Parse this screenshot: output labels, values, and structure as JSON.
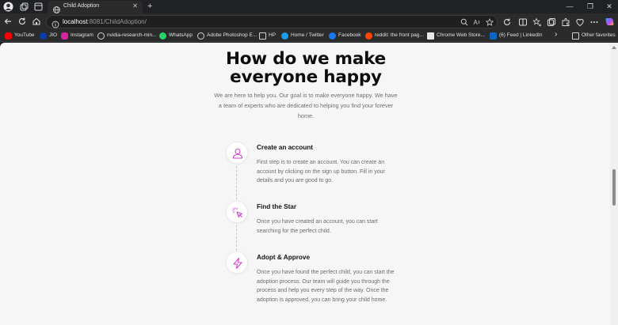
{
  "browser": {
    "tab_title": "Child Adoption",
    "tab_close": "✕",
    "new_tab": "+",
    "url_host": "localhost",
    "url_rest": ":8081/ChildAdoption/",
    "window_controls": {
      "minimize": "—",
      "restore": "❐",
      "close": "✕"
    }
  },
  "bookmarks": [
    {
      "label": "YouTube",
      "icon": "youtube-icon",
      "color": "#ff0000"
    },
    {
      "label": "JIO",
      "icon": "jio-icon",
      "color": "#0a3ea8"
    },
    {
      "label": "Instagram",
      "icon": "instagram-icon",
      "color": "#d6249f"
    },
    {
      "label": "nvidia-research-min...",
      "icon": "globe-icon",
      "color": "#cfcfcf"
    },
    {
      "label": "WhatsApp",
      "icon": "whatsapp-icon",
      "color": "#25d366"
    },
    {
      "label": "Adobe Photoshop E...",
      "icon": "globe-icon",
      "color": "#cfcfcf"
    },
    {
      "label": "HP",
      "icon": "folder-icon",
      "color": "#cfcfcf"
    },
    {
      "label": "Home / Twitter",
      "icon": "twitter-icon",
      "color": "#1d9bf0"
    },
    {
      "label": "Facebook",
      "icon": "facebook-icon",
      "color": "#1877f2"
    },
    {
      "label": "reddit: the front pag...",
      "icon": "reddit-icon",
      "color": "#ff4500"
    },
    {
      "label": "Chrome Web Store...",
      "icon": "webstore-icon",
      "color": "#e8e8e8"
    },
    {
      "label": "(6) Feed | LinkedIn",
      "icon": "linkedin-icon",
      "color": "#0a66c2"
    }
  ],
  "bookmarks_more": "›",
  "other_favorites": "Other favorites",
  "page": {
    "headline": "How do we make everyone happy",
    "subtext": "We are here to help you. Our goal is to make everyone happy. We have a team of experts who are dedicated to helping you find your forever home.",
    "accent_color": "#d63fd6",
    "steps": [
      {
        "icon": "user-icon",
        "title": "Create an account",
        "body": "First step is to create an account. You can create an account by clicking on the sign up button. Fill in your details and you are good to go."
      },
      {
        "icon": "cursor-click-icon",
        "title": "Find the Star",
        "body": "Once you have created an account, you can start searching for the perfect child."
      },
      {
        "icon": "lightning-icon",
        "title": "Adopt & Approve",
        "body": "Once you have found the perfect child, you can start the adoption process. Our team will guide you through the process and help you every step of the way. Once the adoption is approved, you can bring your child home."
      }
    ]
  }
}
